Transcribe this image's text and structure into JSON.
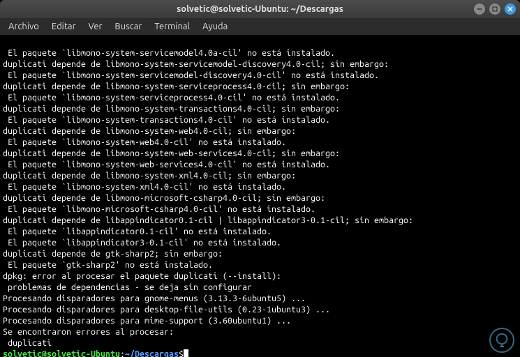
{
  "window": {
    "title": "solvetic@solvetic-Ubuntu: ~/Descargas"
  },
  "menubar": {
    "items": [
      "Archivo",
      "Editar",
      "Ver",
      "Buscar",
      "Terminal",
      "Ayuda"
    ]
  },
  "terminal": {
    "lines": [
      " El paquete `libmono-system-servicemodel4.0a-cil' no está instalado.",
      "duplicati depende de libmono-system-servicemodel-discovery4.0-cil; sin embargo:",
      " El paquete `libmono-system-servicemodel-discovery4.0-cil' no está instalado.",
      "duplicati depende de libmono-system-serviceprocess4.0-cil; sin embargo:",
      " El paquete `libmono-system-serviceprocess4.0-cil' no está instalado.",
      "duplicati depende de libmono-system-transactions4.0-cil; sin embargo:",
      " El paquete `libmono-system-transactions4.0-cil' no está instalado.",
      "duplicati depende de libmono-system-web4.0-cil; sin embargo:",
      " El paquete `libmono-system-web4.0-cil' no está instalado.",
      "duplicati depende de libmono-system-web-services4.0-cil; sin embargo:",
      " El paquete `libmono-system-web-services4.0-cil' no está instalado.",
      "duplicati depende de libmono-system-xml4.0-cil; sin embargo:",
      " El paquete `libmono-system-xml4.0-cil' no está instalado.",
      "duplicati depende de libmono-microsoft-csharp4.0-cil; sin embargo:",
      " El paquete `libmono-microsoft-csharp4.0-cil' no está instalado.",
      "duplicati depende de libappindicator0.1-cil | libappindicator3-0.1-cil; sin embargo:",
      " El paquete `libappindicator0.1-cil' no está instalado.",
      " El paquete `libappindicator3-0.1-cil' no está instalado.",
      "duplicati depende de gtk-sharp2; sin embargo:",
      " El paquete `gtk-sharp2' no está instalado.",
      "",
      "dpkg: error al procesar el paquete duplicati (--install):",
      " problemas de dependencias - se deja sin configurar",
      "Procesando disparadores para gnome-menus (3.13.3-6ubuntu5) ...",
      "Procesando disparadores para desktop-file-utils (0.23-1ubuntu3) ...",
      "Procesando disparadores para mime-support (3.60ubuntu1) ...",
      "Se encontraron errores al procesar:",
      " duplicati"
    ],
    "prompt": {
      "user_host": "solvetic@solvetic-Ubuntu",
      "colon": ":",
      "path": "~/Descargas",
      "symbol": "$"
    }
  }
}
